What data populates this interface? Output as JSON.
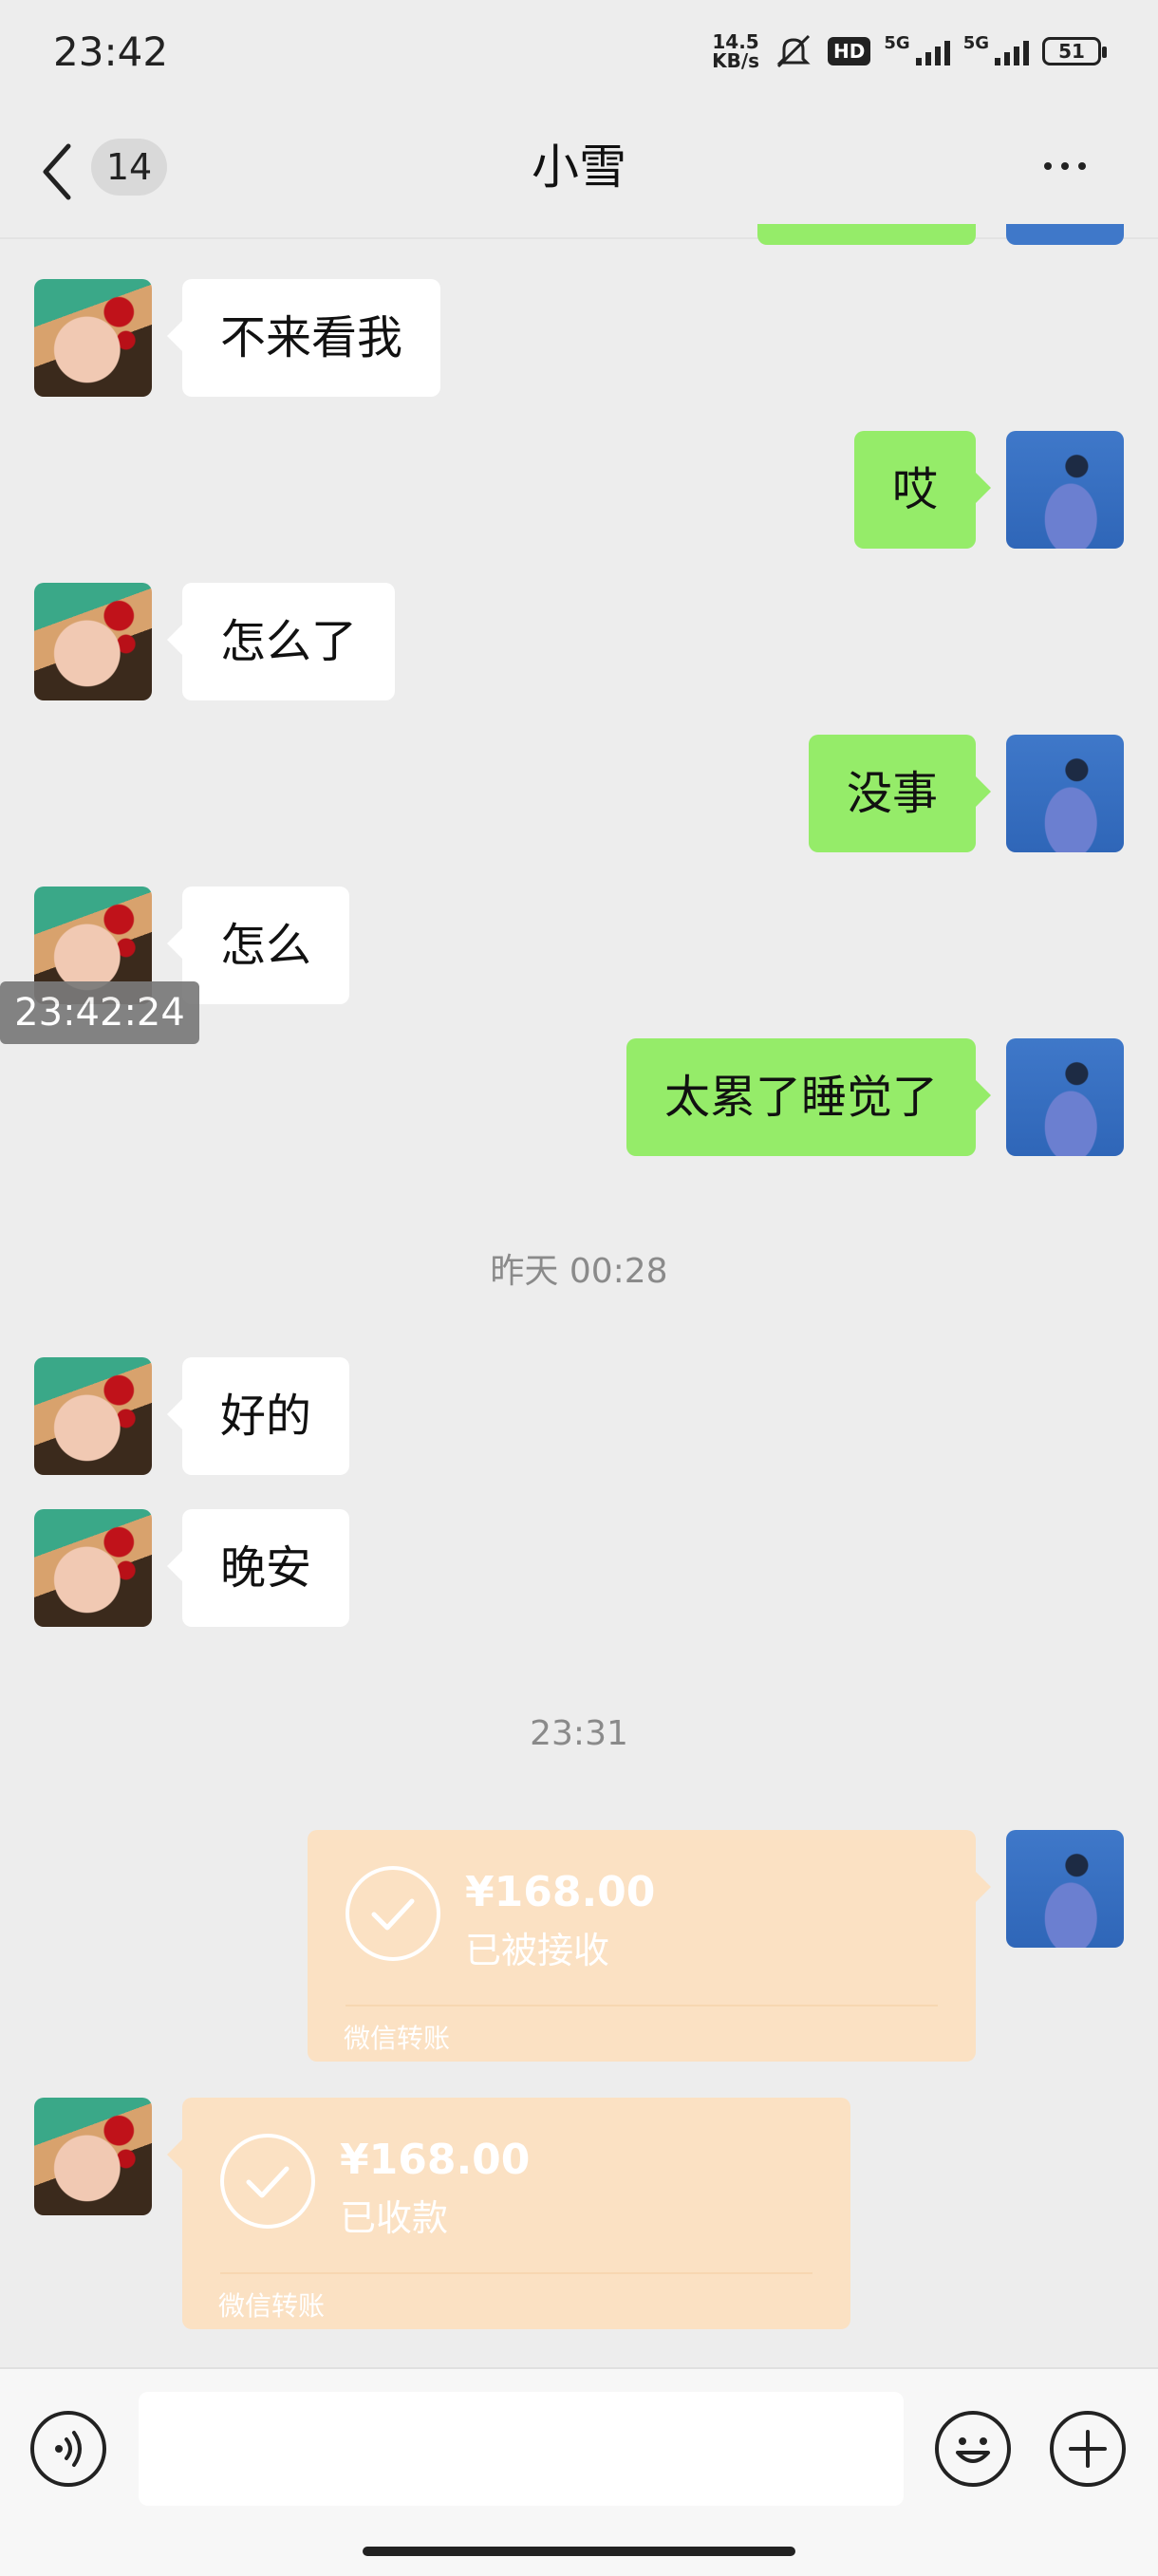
{
  "status_bar": {
    "time": "23:42",
    "net_speed_value": "14.5",
    "net_speed_unit": "KB/s",
    "hd_label": "HD",
    "net_5g_1": "5G",
    "net_5g_2": "5G",
    "battery": "51"
  },
  "nav": {
    "unread_count": "14",
    "title": "小雪"
  },
  "messages": [
    {
      "side": "left",
      "text": "不来看我"
    },
    {
      "side": "right",
      "text": "哎"
    },
    {
      "side": "left",
      "text": "怎么了"
    },
    {
      "side": "right",
      "text": "没事"
    },
    {
      "side": "left",
      "text": "怎么"
    },
    {
      "side": "right",
      "text": "太累了睡觉了"
    },
    {
      "side": "left",
      "text": "好的"
    },
    {
      "side": "left",
      "text": "晚安"
    }
  ],
  "floating_timestamp": "23:42:24",
  "timestamps": {
    "yesterday": "昨天 00:28",
    "today": "23:31"
  },
  "transfers": [
    {
      "side": "right",
      "amount": "¥168.00",
      "status": "已被接收",
      "label": "微信转账"
    },
    {
      "side": "left",
      "amount": "¥168.00",
      "status": "已收款",
      "label": "微信转账"
    }
  ],
  "input": {
    "value": ""
  },
  "colors": {
    "sent_bubble": "#95ec69",
    "received_bubble": "#ffffff",
    "transfer_card": "#fbe1c3",
    "background": "#ededed"
  }
}
